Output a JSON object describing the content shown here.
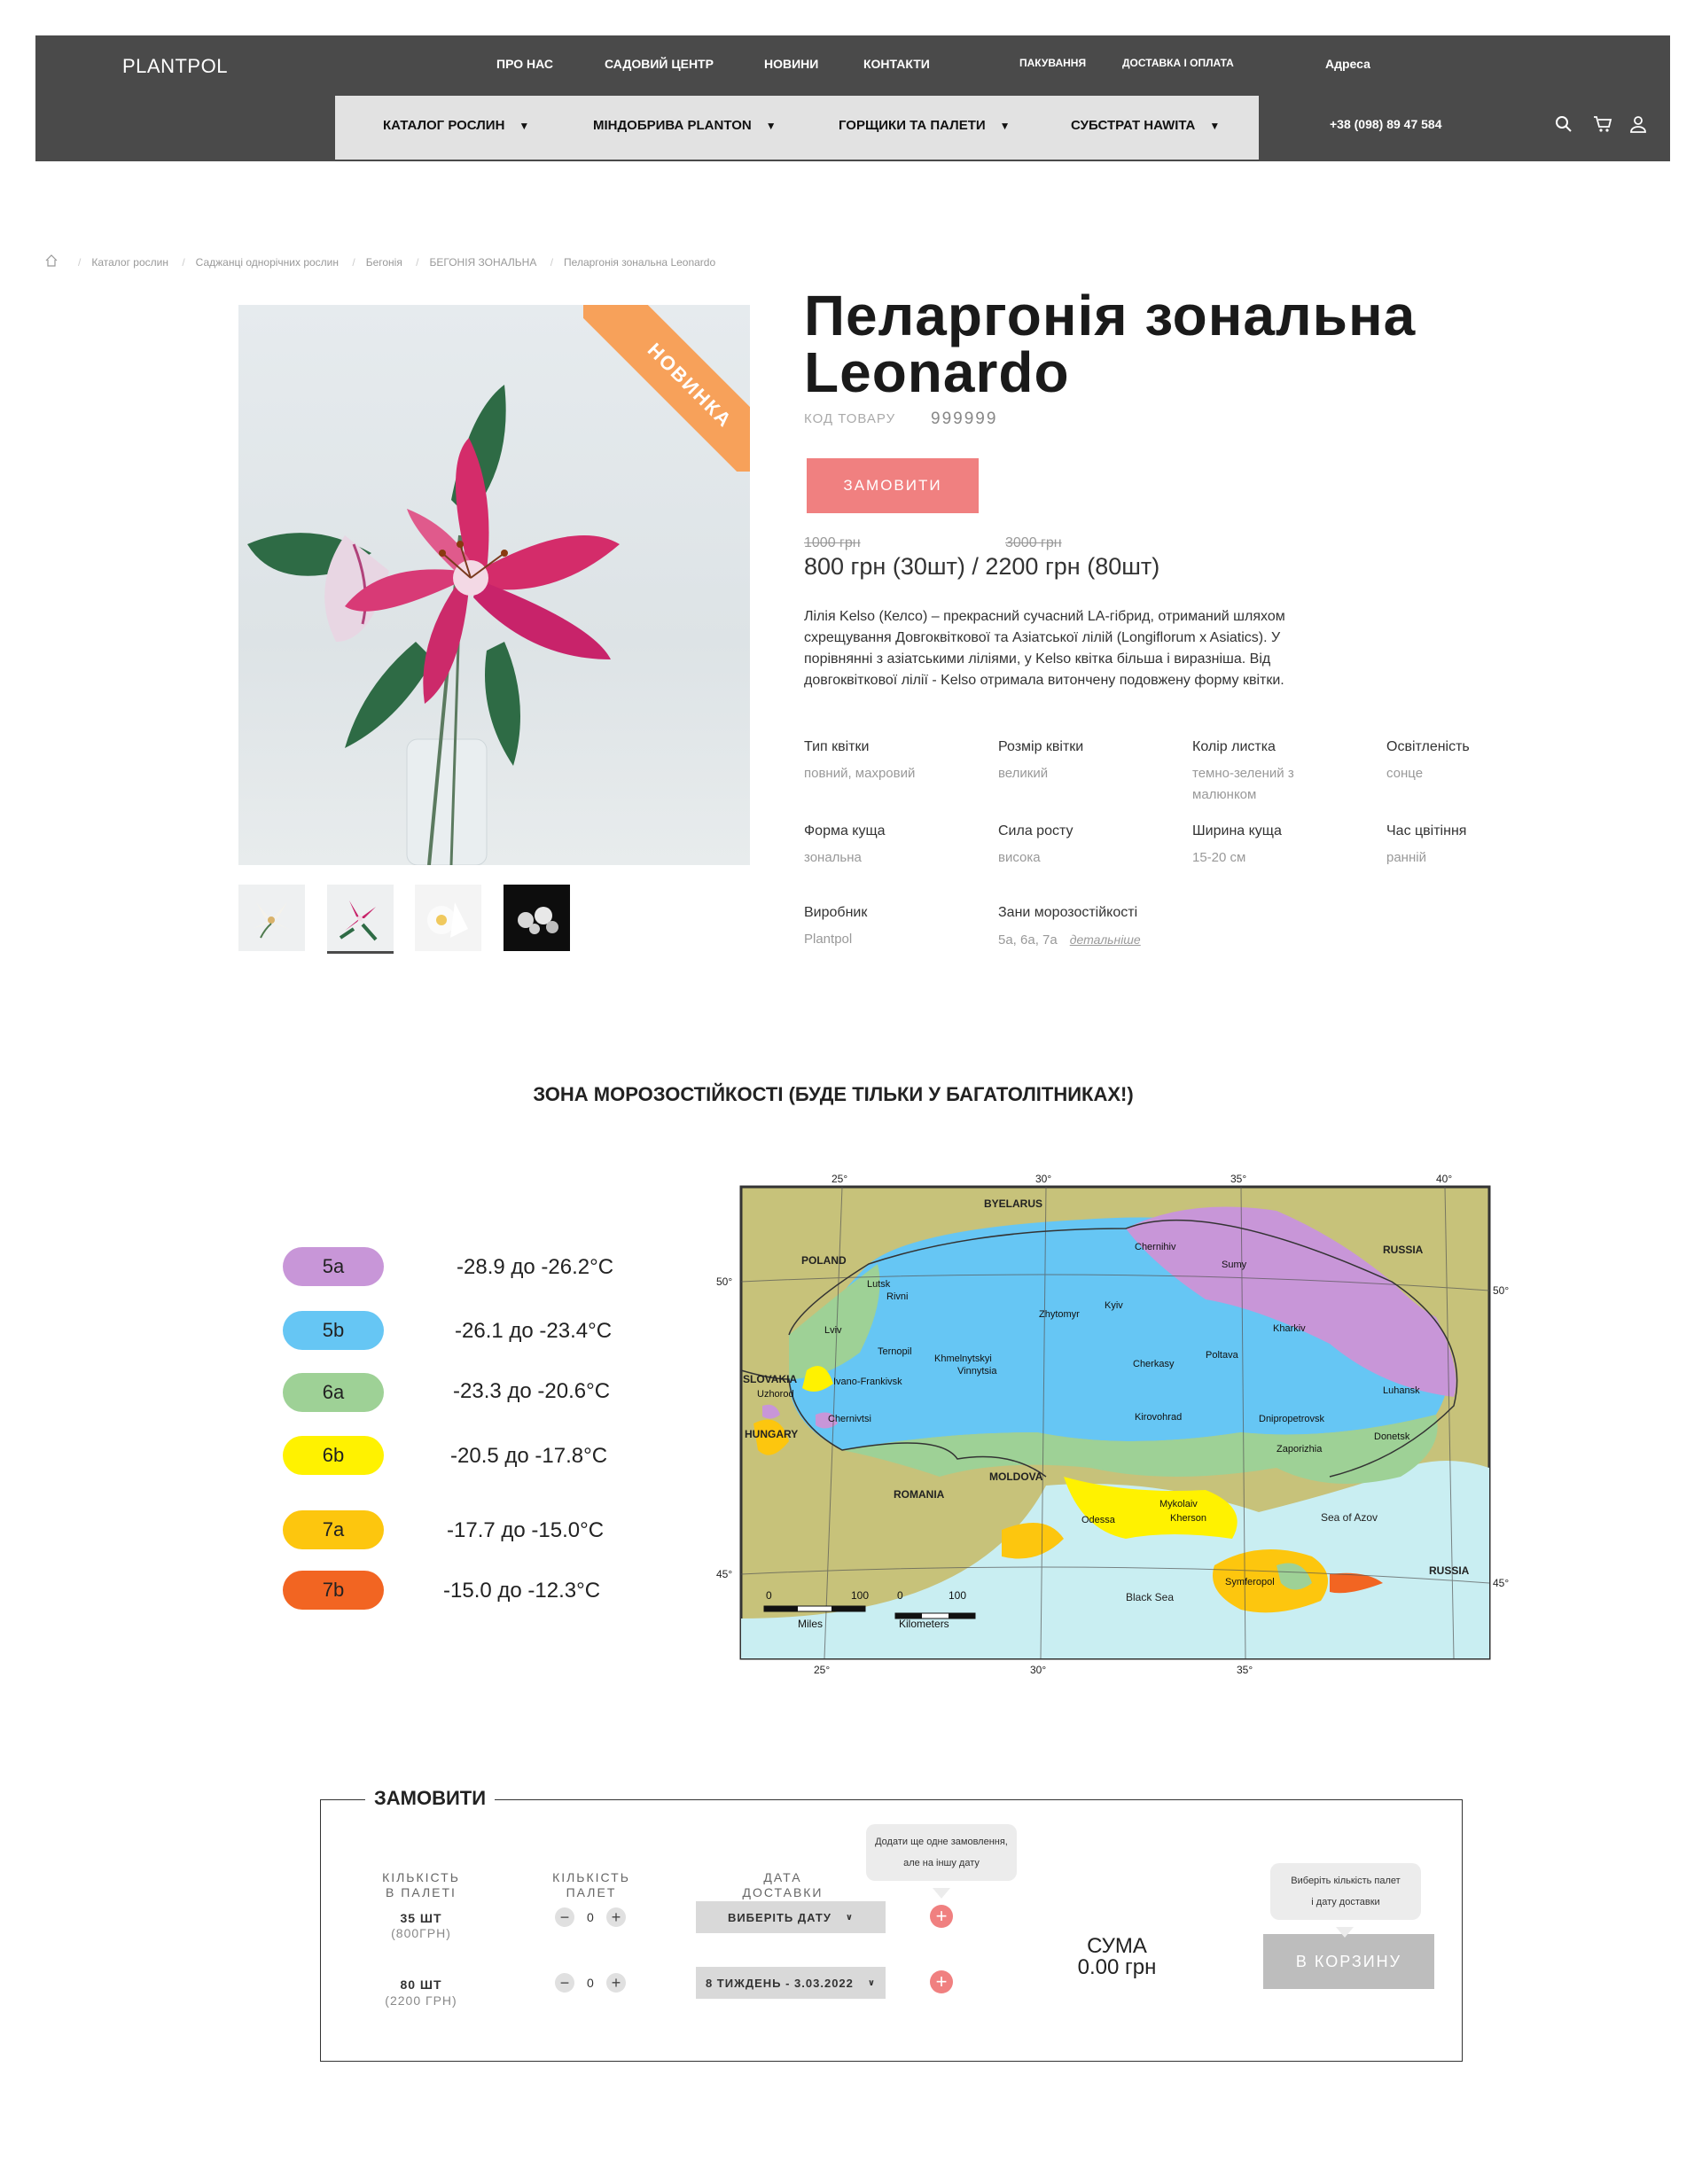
{
  "header": {
    "logo": "PLANTPOL",
    "top_nav": [
      "ПРО НАС",
      "САДОВИЙ ЦЕНТР",
      "НОВИНИ",
      "КОНТАКТИ"
    ],
    "top_nav_small": [
      "ПАКУВАННЯ",
      "ДОСТАВКА І ОПЛАТА"
    ],
    "address": "Адреса",
    "catalog_menu": [
      "КАТАЛОГ РОСЛИН",
      "МІНДОБРИВА PLANTON",
      "ГОРЩИКИ ТА ПАЛЕТИ",
      "СУБСТРАТ HAWITA"
    ],
    "dropdown_glyph": "▼",
    "phone": "+38 (098) 89 47 584",
    "icons": [
      "search-icon",
      "cart-icon",
      "user-icon"
    ]
  },
  "breadcrumb": [
    "Каталог рослин",
    "Саджанці однорічних рослин",
    "Бегонія",
    "БЕГОНІЯ ЗОНАЛЬНА",
    "Пеларгонія зональна Leonardo"
  ],
  "product": {
    "badge": "НОВИНКА",
    "title_line1": "Пеларгонія зональна",
    "title_line2": "Leonardo",
    "sku_label": "КОД ТОВАРУ",
    "sku_value": "999999",
    "order_button": "ЗАМОВИТИ",
    "old_price_1": "1000 грн",
    "old_price_2": "3000 грн",
    "price": "800 грн (30шт) / 2200 грн (80шт)",
    "description": "Лілія Kelso (Келсо) – прекрасний сучасний LA-гібрид, отриманий шляхом схрещування Довгоквіткової та Азіатської лілій (Longiflorum x Asiatics). У порівнянні з азіатськими ліліями, у Kelso квітка більша і виразніша. Від довгоквіткової лілії - Kelso отримала витончену подовжену форму квітки.",
    "attributes": [
      {
        "label": "Тип квітки",
        "value": "повний, махровий"
      },
      {
        "label": "Розмір квітки",
        "value": "великий"
      },
      {
        "label": "Колір листка",
        "value": "темно-зелений з малюнком"
      },
      {
        "label": "Освітленість",
        "value": "сонце"
      },
      {
        "label": "Форма куща",
        "value": "зональна"
      },
      {
        "label": "Сила росту",
        "value": "висока"
      },
      {
        "label": "Ширина куща",
        "value": "15-20 см"
      },
      {
        "label": "Час цвітіння",
        "value": "ранній"
      },
      {
        "label": "Виробник",
        "value": "Plantpol"
      },
      {
        "label": "Зани морозостійкості",
        "value": "5а, 6а, 7а"
      }
    ],
    "details_link": "детальніше"
  },
  "zones": {
    "heading": "ЗОНА МОРОЗОСТІЙКОСТІ (БУДЕ ТІЛЬКИ У БАГАТОЛІТНИКАХ!)",
    "items": [
      {
        "zone": "5a",
        "range": "-28.9 до -26.2°C",
        "color": "#c896d8"
      },
      {
        "zone": "5b",
        "range": "-26.1 до -23.4°C",
        "color": "#66c6f4"
      },
      {
        "zone": "6a",
        "range": "-23.3 до -20.6°C",
        "color": "#9ed196"
      },
      {
        "zone": "6b",
        "range": "-20.5 до -17.8°C",
        "color": "#fff200"
      },
      {
        "zone": "7a",
        "range": "-17.7 до -15.0°C",
        "color": "#fdc60e"
      },
      {
        "zone": "7b",
        "range": "-15.0 до -12.3°C",
        "color": "#f26522"
      }
    ],
    "map": {
      "lon_labels": [
        "25°",
        "30°",
        "35°",
        "40°"
      ],
      "lat_labels": [
        "50°",
        "45°"
      ],
      "countries": [
        "BYELARUS",
        "POLAND",
        "RUSSIA",
        "SLOVAKIA",
        "HUNGARY",
        "ROMANIA",
        "MOLDOVA",
        "RUSSIA"
      ],
      "seas": [
        "Black Sea",
        "Sea of Azov"
      ],
      "cities": [
        "Chernihiv",
        "Sumy",
        "Lutsk",
        "Rivni",
        "Kyiv",
        "Zhytomyr",
        "Kharkiv",
        "Lviv",
        "Ternopil",
        "Khmelnytskyi",
        "Vinnytsia",
        "Cherkasy",
        "Poltava",
        "Luhansk",
        "Ivano-Frankivsk",
        "Uzhorod",
        "Chernivtsi",
        "Kirovohrad",
        "Dnipropetrovsk",
        "Donetsk",
        "Zaporizhia",
        "Mykolaiv",
        "Odessa",
        "Kherson",
        "Symferopol"
      ],
      "scale": [
        "0",
        "100",
        "Miles",
        "0",
        "100",
        "Kilometers"
      ]
    }
  },
  "order": {
    "legend": "ЗАМОВИТИ",
    "col_qty_per_pallet": [
      "КІЛЬКІСТЬ",
      "В ПАЛЕТІ"
    ],
    "col_pallets": [
      "КІЛЬКІСТЬ",
      "ПАЛЕТ"
    ],
    "col_date": [
      "ДАТА",
      "ДОСТАВКИ"
    ],
    "rows": [
      {
        "qty": "35 ШТ",
        "sub": "(800ГРН)",
        "count": "0",
        "date": "ВИБЕРІТЬ ДАТУ"
      },
      {
        "qty": "80 ШТ",
        "sub": "(2200 ГРН)",
        "count": "0",
        "date": "8 ТИЖДЕНЬ - 3.03.2022"
      }
    ],
    "tooltip_add": [
      "Додати ще одне замовлення,",
      "але на іншу дату"
    ],
    "tooltip_cart": [
      "Виберіть кількість палет",
      "і дату доставки"
    ],
    "sum_label": "СУМА",
    "sum_value": "0.00 грн",
    "cart_button": "В КОРЗИНУ",
    "minus": "−",
    "plus": "+",
    "chevron": "∨"
  }
}
